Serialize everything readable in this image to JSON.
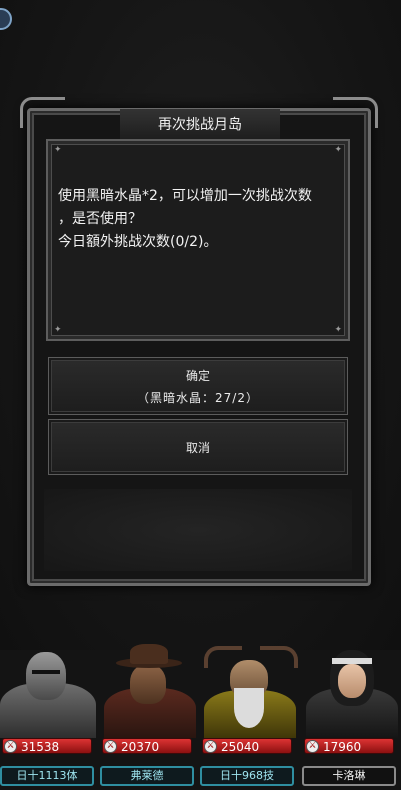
{
  "dialog": {
    "title": "再次挑战月岛",
    "message_line1": "使用黑暗水晶*2，可以增加一次挑战次数",
    "message_line2": "，是否使用？",
    "message_line3": "今日額外挑战次数(0/2)。",
    "confirm_label": "确定",
    "confirm_cost": "（黑暗水晶：27/2）",
    "cancel_label": "取消"
  },
  "heroes": [
    {
      "power": "31538",
      "name": "日十1113体"
    },
    {
      "power": "20370",
      "name": "弗莱德"
    },
    {
      "power": "25040",
      "name": "日十968技"
    },
    {
      "power": "17960",
      "name": "卡洛琳"
    }
  ],
  "colors": {
    "power_bar": "#c81e1e",
    "name_border": "#2f8ea0",
    "frame": "#6b6b6b"
  }
}
